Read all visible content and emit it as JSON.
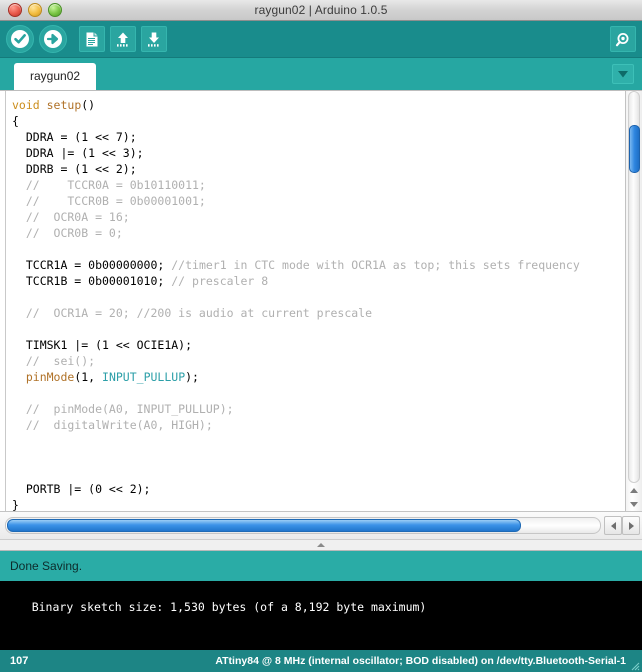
{
  "window": {
    "title": "raygun02 | Arduino 1.0.5",
    "traffic_lights": [
      "close-button",
      "minimize-button",
      "zoom-button"
    ]
  },
  "toolbar": {
    "buttons": [
      {
        "name": "verify-button",
        "label": "Verify",
        "icon": "check-circle-icon"
      },
      {
        "name": "upload-button",
        "label": "Upload",
        "icon": "arrow-right-circle-icon"
      },
      {
        "name": "new-button",
        "label": "New",
        "icon": "document-icon"
      },
      {
        "name": "open-button",
        "label": "Open",
        "icon": "arrow-up-icon"
      },
      {
        "name": "save-button",
        "label": "Save",
        "icon": "arrow-down-icon"
      }
    ],
    "serial_monitor": {
      "name": "serial-monitor-button",
      "label": "Serial Monitor",
      "icon": "magnifier-icon"
    },
    "background_color": "#198c8c"
  },
  "tabs": {
    "items": [
      {
        "label": "raygun02",
        "active": true
      }
    ],
    "menu_icon": "chevron-down-icon",
    "background_color": "#26a7a2"
  },
  "editor": {
    "lines": [
      [
        {
          "t": "void ",
          "c": "kw"
        },
        {
          "t": "setup",
          "c": "fn"
        },
        {
          "t": "()",
          "c": ""
        }
      ],
      [
        {
          "t": "{",
          "c": ""
        }
      ],
      [
        {
          "t": "  DDRA = (1 << 7);",
          "c": ""
        }
      ],
      [
        {
          "t": "  DDRA |= (1 << 3);",
          "c": "",
          "caret": true
        }
      ],
      [
        {
          "t": "  DDRB = (1 << 2);",
          "c": ""
        }
      ],
      [
        {
          "t": "  //    TCCR0A = 0b10110011;",
          "c": "cm"
        }
      ],
      [
        {
          "t": "  //    TCCR0B = 0b00001001;",
          "c": "cm"
        }
      ],
      [
        {
          "t": "  //  OCR0A = 16;",
          "c": "cm"
        }
      ],
      [
        {
          "t": "  //  OCR0B = 0;",
          "c": "cm"
        }
      ],
      [
        {
          "t": "",
          "c": ""
        }
      ],
      [
        {
          "t": "  TCCR1A = 0b00000000; ",
          "c": ""
        },
        {
          "t": "//timer1 in CTC mode with OCR1A as top; this sets frequency",
          "c": "cm"
        }
      ],
      [
        {
          "t": "  TCCR1B = 0b00001010; ",
          "c": ""
        },
        {
          "t": "// prescaler 8",
          "c": "cm"
        }
      ],
      [
        {
          "t": "",
          "c": ""
        }
      ],
      [
        {
          "t": "  //  OCR1A = 20; //200 is audio at current prescale",
          "c": "cm"
        }
      ],
      [
        {
          "t": "",
          "c": ""
        }
      ],
      [
        {
          "t": "  TIMSK1 |= (1 << OCIE1A);",
          "c": ""
        }
      ],
      [
        {
          "t": "  //  sei();",
          "c": "cm"
        }
      ],
      [
        {
          "t": "  ",
          "c": ""
        },
        {
          "t": "pinMode",
          "c": "fn"
        },
        {
          "t": "(1, ",
          "c": ""
        },
        {
          "t": "INPUT_PULLUP",
          "c": "cst"
        },
        {
          "t": ");",
          "c": ""
        }
      ],
      [
        {
          "t": "",
          "c": ""
        }
      ],
      [
        {
          "t": "  //  pinMode(A0, INPUT_PULLUP);",
          "c": "cm"
        }
      ],
      [
        {
          "t": "  //  digitalWrite(A0, HIGH);",
          "c": "cm"
        }
      ],
      [
        {
          "t": "",
          "c": ""
        }
      ],
      [
        {
          "t": "",
          "c": ""
        }
      ],
      [
        {
          "t": "",
          "c": ""
        }
      ],
      [
        {
          "t": "  PORTB |= (0 << 2);",
          "c": ""
        }
      ],
      [
        {
          "t": "}",
          "c": ""
        }
      ]
    ],
    "colors": {
      "keyword": "#cc8e1c",
      "function": "#b07228",
      "comment": "#b0b0b0",
      "constant": "#2c9fa8",
      "text": "#000000",
      "background": "#ffffff"
    }
  },
  "scrollbars": {
    "vertical": {
      "name": "editor-vertical-scrollbar"
    },
    "horizontal": {
      "name": "editor-horizontal-scrollbar"
    }
  },
  "status": {
    "message": "Done Saving.",
    "background_color": "#2aaca6"
  },
  "console": {
    "text": "Binary sketch size: 1,530 bytes (of a 8,192 byte maximum)",
    "background_color": "#000000"
  },
  "bottom_bar": {
    "line_number": "107",
    "board_info": "ATtiny84 @ 8 MHz  (internal oscillator; BOD disabled) on /dev/tty.Bluetooth-Serial-1",
    "background_color": "#1d8585"
  }
}
